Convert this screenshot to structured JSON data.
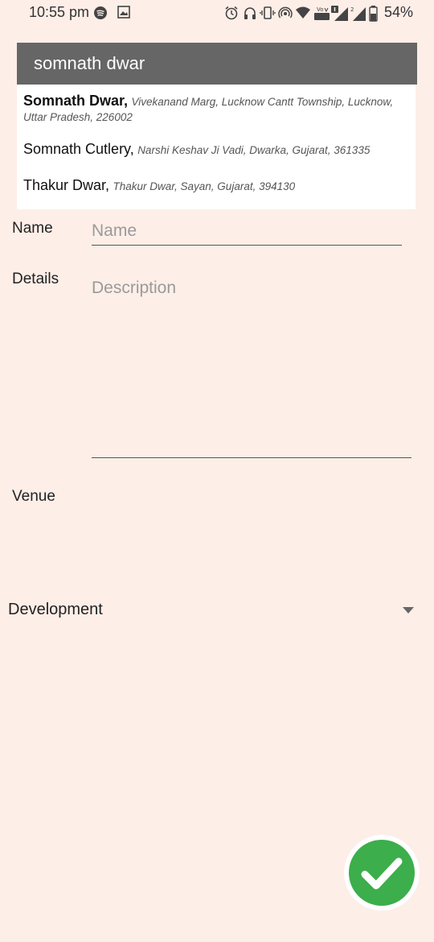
{
  "status_bar": {
    "time": "10:55 pm",
    "battery": "54%",
    "icons": [
      "spotify-icon",
      "image-icon",
      "alarm-icon",
      "headset-icon",
      "vibrate-icon",
      "hotspot-icon",
      "wifi-icon",
      "volte-icon",
      "signal-icon",
      "signal-2-icon",
      "battery-icon"
    ]
  },
  "autocomplete": {
    "query": "somnath dwar",
    "suggestions": [
      {
        "name": "Somnath Dwar,",
        "address": "Vivekanand Marg, Lucknow Cantt Township, Lucknow,",
        "address_line2": "Uttar Pradesh, 226002"
      },
      {
        "name": "Somnath Cutlery,",
        "address": "Narshi Keshav Ji Vadi, Dwarka, Gujarat, 361335"
      },
      {
        "name": "Thakur Dwar,",
        "address": "Thakur Dwar, Sayan, Gujarat, 394130"
      }
    ]
  },
  "form": {
    "name_label": "Name",
    "name_placeholder": "Name",
    "details_label": "Details",
    "details_placeholder": "Description",
    "venue_label": "Venue",
    "category_value": "Development"
  },
  "colors": {
    "background": "#fdeee8",
    "search_bar": "#666666",
    "fab_green": "#3cae4b"
  },
  "fab": {
    "icon": "check-icon"
  }
}
